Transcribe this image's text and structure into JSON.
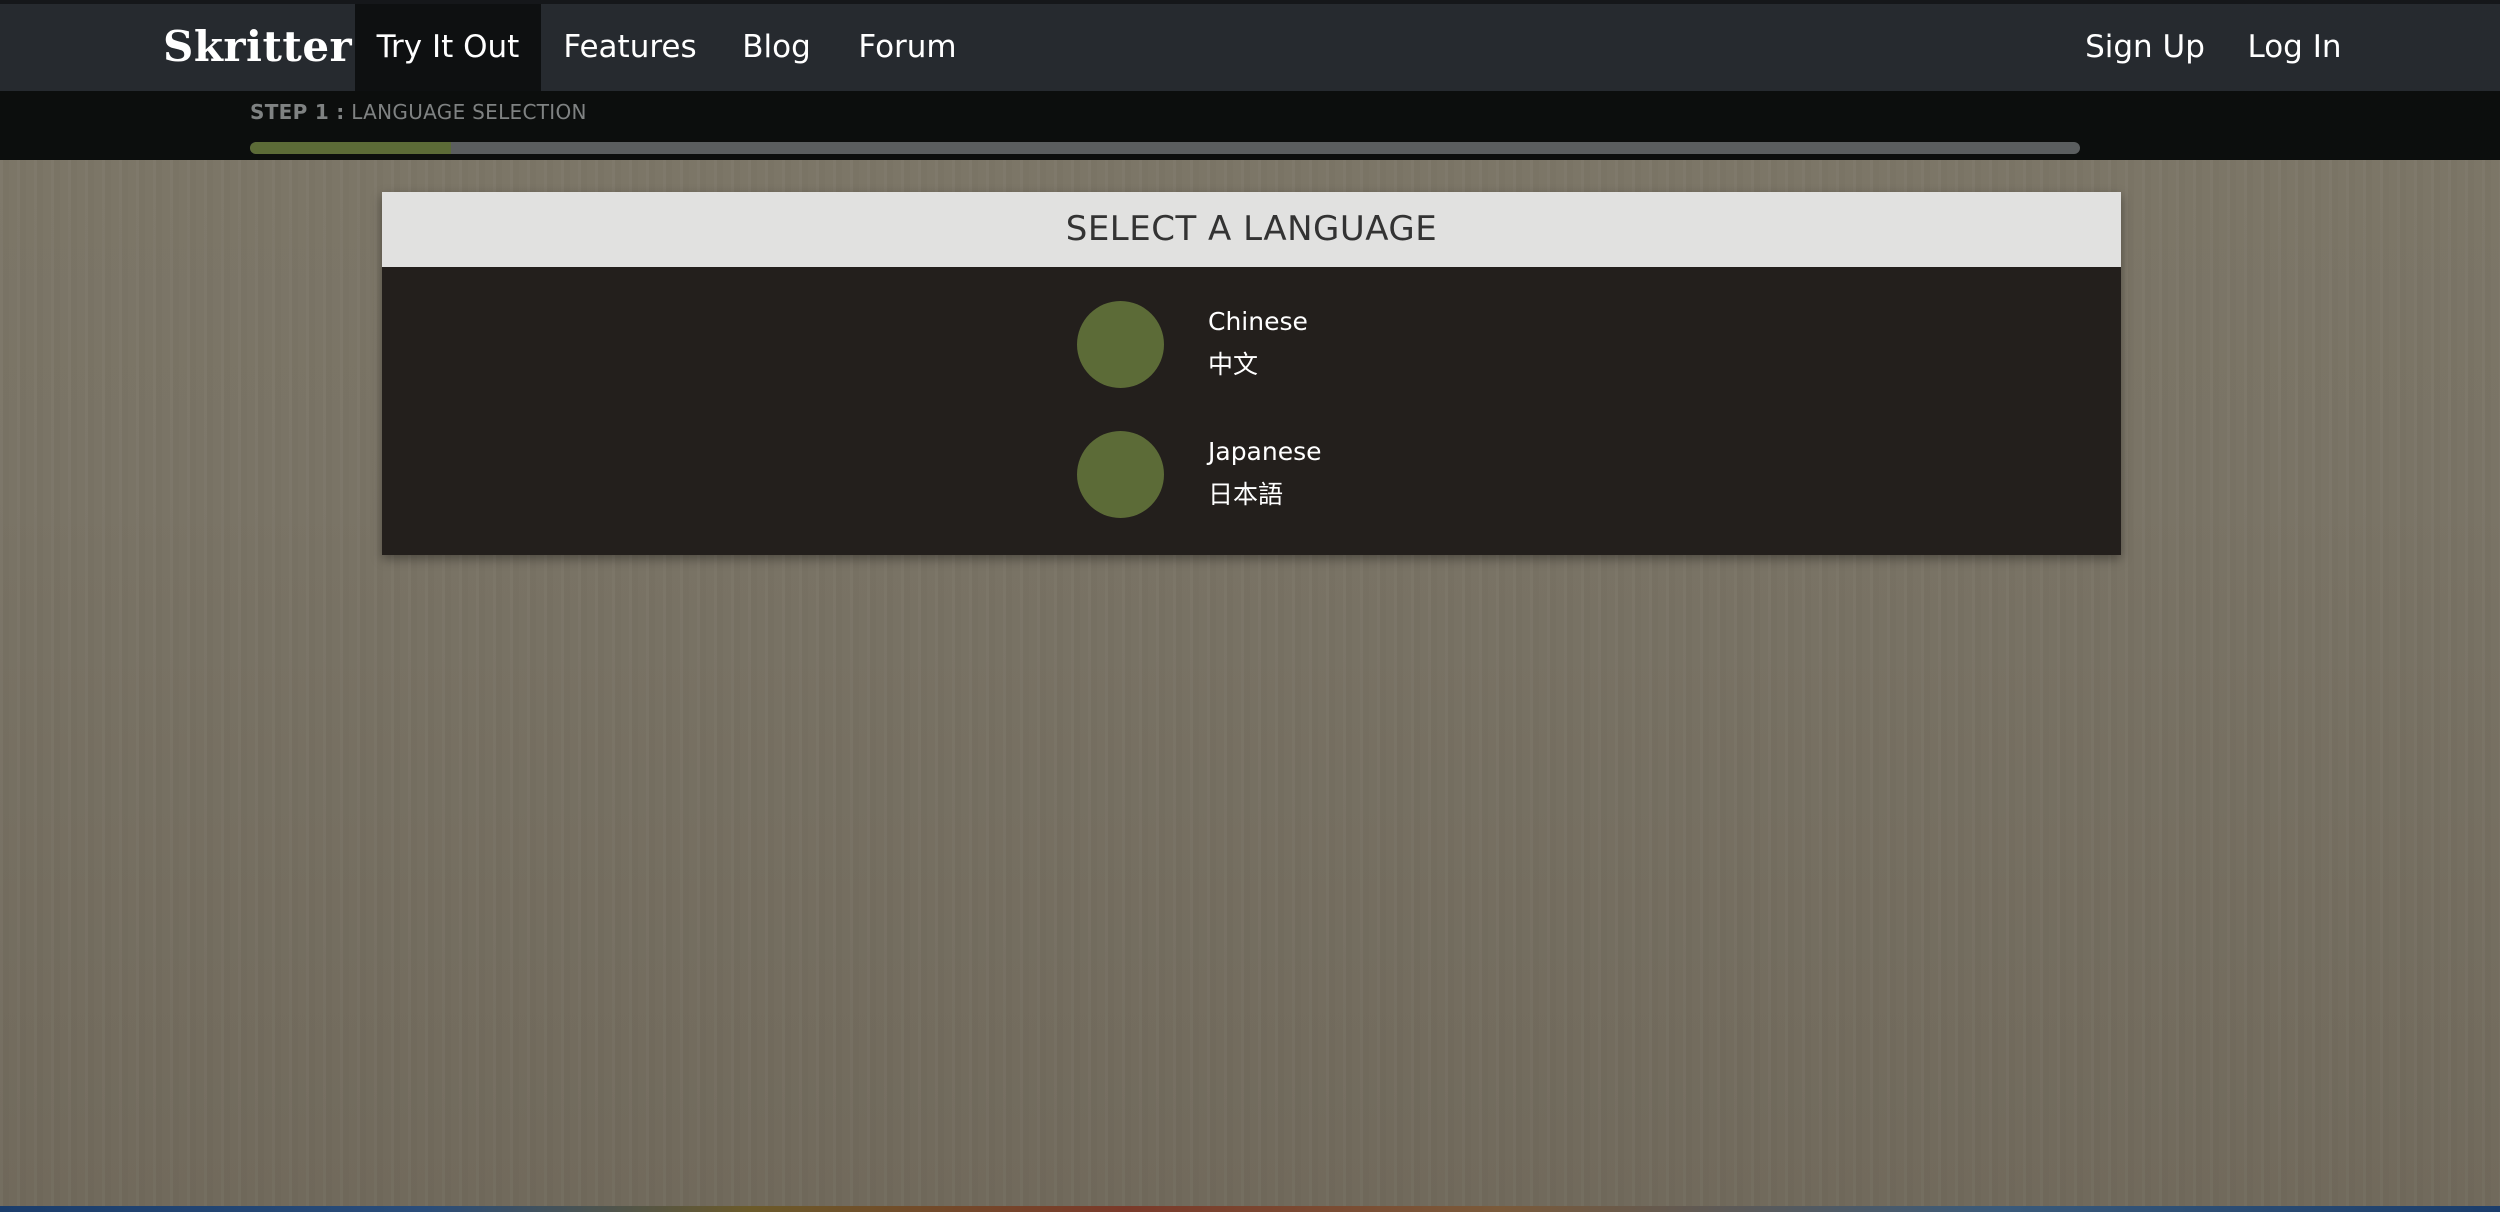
{
  "navbar": {
    "brand": "Skritter",
    "links": [
      {
        "label": "Try It Out",
        "active": true
      },
      {
        "label": "Features",
        "active": false
      },
      {
        "label": "Blog",
        "active": false
      },
      {
        "label": "Forum",
        "active": false
      }
    ],
    "right_links": [
      {
        "label": "Sign Up"
      },
      {
        "label": "Log In"
      }
    ]
  },
  "step": {
    "prefix": "STEP 1 :",
    "name": "LANGUAGE SELECTION",
    "progress_fraction": 0.11
  },
  "card": {
    "title": "SELECT A LANGUAGE",
    "languages": [
      {
        "name": "Chinese",
        "native": "中文"
      },
      {
        "name": "Japanese",
        "native": "日本語"
      }
    ]
  },
  "colors": {
    "accent_green": "#5c6b37",
    "nav_bg": "#262a2f",
    "card_body_bg": "#231f1c"
  }
}
